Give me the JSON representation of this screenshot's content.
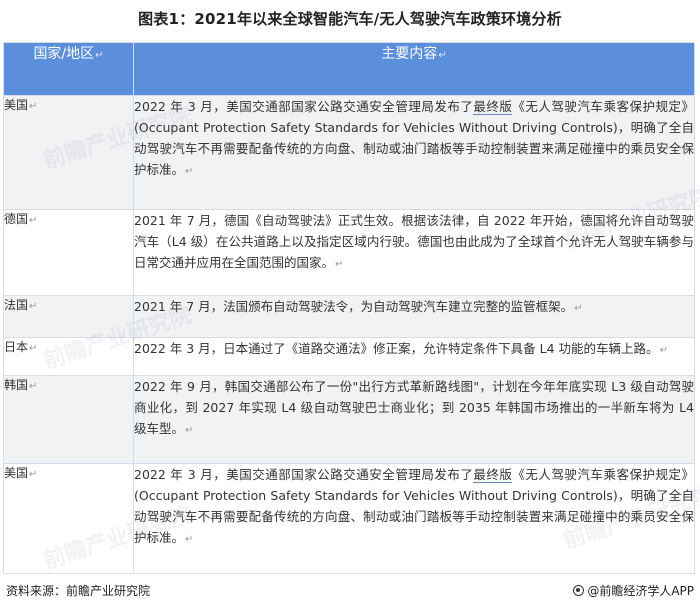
{
  "title": "图表1：2021年以来全球智能汽车/无人驾驶汽车政策环境分析",
  "table": {
    "headers": [
      "国家/地区",
      "主要内容"
    ],
    "rows": [
      {
        "country": "美国",
        "content_pre": "2022 年 3 月，美国交通部国家公路交通安全管理局发布了",
        "content_underline": "最终版",
        "content_post": "《无人驾驶汽车乘客保护规定》(Occupant Protection Safety Standards for Vehicles Without Driving Controls)，明确了全自动驾驶汽车不再需要配备传统的方向盘、制动或油门踏板等手动控制装置来满足碰撞中的乘员安全保护标准。"
      },
      {
        "country": "德国",
        "content_pre": "2021 年 7 月，德国《自动驾驶法》正式生效。根据该法律，自 2022 年开始，德国将允许自动驾驶汽车（L4 级）在公共道路上以及指定区域内行驶。德国也由此成为了全球首个允许无人驾驶车辆参与日常交通并应用在全国范围的国家。",
        "content_underline": "",
        "content_post": ""
      },
      {
        "country": "法国",
        "content_pre": "2021 年 7 月，法国颁布自动驾驶法令，为自动驾驶汽车建立完整的监管框架。",
        "content_underline": "",
        "content_post": ""
      },
      {
        "country": "日本",
        "content_pre": "2022 年 3 月，日本通过了《道路交通法》修正案，允许特定条件下具备 L4 功能的车辆上路。",
        "content_underline": "",
        "content_post": ""
      },
      {
        "country": "韩国",
        "content_pre": "2022 年 9 月，韩国交通部公布了一份\"出行方式革新路线图\"，计划在今年年底实现 L3 级自动驾驶商业化，到 2027 年实现 L4 级自动驾驶巴士商业化；到 2035 年韩国市场推出的一半新车将为 L4 级车型。",
        "content_underline": "",
        "content_post": ""
      },
      {
        "country": "美国",
        "content_pre": "2022 年 3 月，美国交通部国家公路交通安全管理局发布了",
        "content_underline": "最终版",
        "content_post": "《无人驾驶汽车乘客保护规定》(Occupant Protection Safety Standards for Vehicles Without Driving Controls)，明确了全自动驾驶汽车不再需要配备传统的方向盘、制动或油门踏板等手动控制装置来满足碰撞中的乘员安全保护标准。"
      }
    ]
  },
  "paragraph_mark": "↵",
  "footer": {
    "source": "资料来源：前瞻产业研究院",
    "brand": "@前瞻经济学人APP"
  },
  "watermark_text": "前瞻产业研究院",
  "colors": {
    "header_bg": "#5b8edb",
    "row_alt_bg": "#f1f2f4"
  }
}
